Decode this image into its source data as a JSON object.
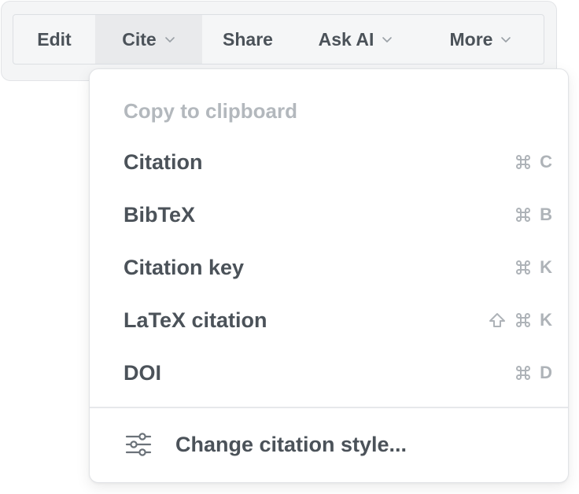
{
  "toolbar": {
    "buttons": [
      {
        "label": "Edit",
        "has_dropdown": false,
        "active": false
      },
      {
        "label": "Cite",
        "has_dropdown": true,
        "active": true
      },
      {
        "label": "Share",
        "has_dropdown": false,
        "active": false
      },
      {
        "label": "Ask AI",
        "has_dropdown": true,
        "active": false
      },
      {
        "label": "More",
        "has_dropdown": true,
        "active": false
      }
    ]
  },
  "cite_menu": {
    "section_label": "Copy to clipboard",
    "items": [
      {
        "label": "Citation",
        "shortcut_key": "C",
        "shortcut_icons": [
          "command-icon"
        ]
      },
      {
        "label": "BibTeX",
        "shortcut_key": "B",
        "shortcut_icons": [
          "command-icon"
        ]
      },
      {
        "label": "Citation key",
        "shortcut_key": "K",
        "shortcut_icons": [
          "command-icon"
        ]
      },
      {
        "label": "LaTeX citation",
        "shortcut_key": "K",
        "shortcut_icons": [
          "shift-icon",
          "command-icon"
        ]
      },
      {
        "label": "DOI",
        "shortcut_key": "D",
        "shortcut_icons": [
          "command-icon"
        ]
      }
    ],
    "footer": {
      "label": "Change citation style...",
      "icon": "sliders-icon"
    }
  },
  "colors": {
    "text": "#4b5259",
    "muted": "#b3b8bd",
    "shortcut": "#aeb3b8",
    "toolbar_bg": "#f5f6f7",
    "active_bg": "#e9eaec",
    "border": "#e1e3e6"
  }
}
